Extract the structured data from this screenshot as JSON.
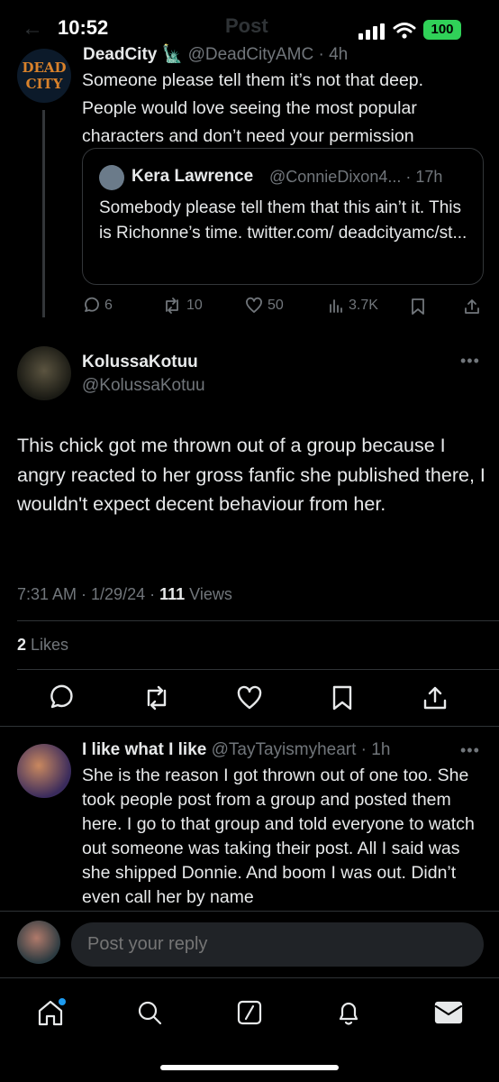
{
  "status_bar": {
    "time": "10:52",
    "battery": "100"
  },
  "header": {
    "title": "Post",
    "back": "←"
  },
  "parent_tweet": {
    "avatar_text": "DEAD CITY",
    "name": "DeadCity 🗽",
    "handle_time": "@DeadCityAMC · 4h",
    "text": "Someone please tell them it’s not that deep. People would love seeing the most popular characters and don’t need your permission",
    "quote": {
      "name": "Kera Lawrence",
      "handle_time": "@ConnieDixon4... · 17h",
      "text": "Somebody please tell them that this ain’t it. This is Richonne’s time. twitter.com/ deadcityamc/st..."
    },
    "actions": {
      "replies": "6",
      "reposts": "10",
      "likes": "50",
      "views": "3.7K"
    }
  },
  "main_tweet": {
    "name": "KolussaKotuu",
    "handle": "@KolussaKotuu",
    "more": "•••",
    "text": "This chick got me thrown out of a group because I angry reacted to her gross fanfic she published there, I wouldn't expect decent behaviour from her.",
    "timestamp": "7:31 AM · 1/29/24 · ",
    "views_count": "111",
    "views_label": " Views",
    "likes_count": "2",
    "likes_label": " Likes"
  },
  "reply_tweet": {
    "name": "I like what I like",
    "handle_time": " @TayTayismyheart · 1h",
    "more": "•••",
    "text": "She is the reason I got thrown out of one too. She took people post from a group and posted them here. I go to that group and told everyone to watch out someone was taking their post. All I said was she shipped Donnie. And boom I was out. Didn’t even call her by name"
  },
  "reply_bar": {
    "placeholder": "Post your reply"
  }
}
